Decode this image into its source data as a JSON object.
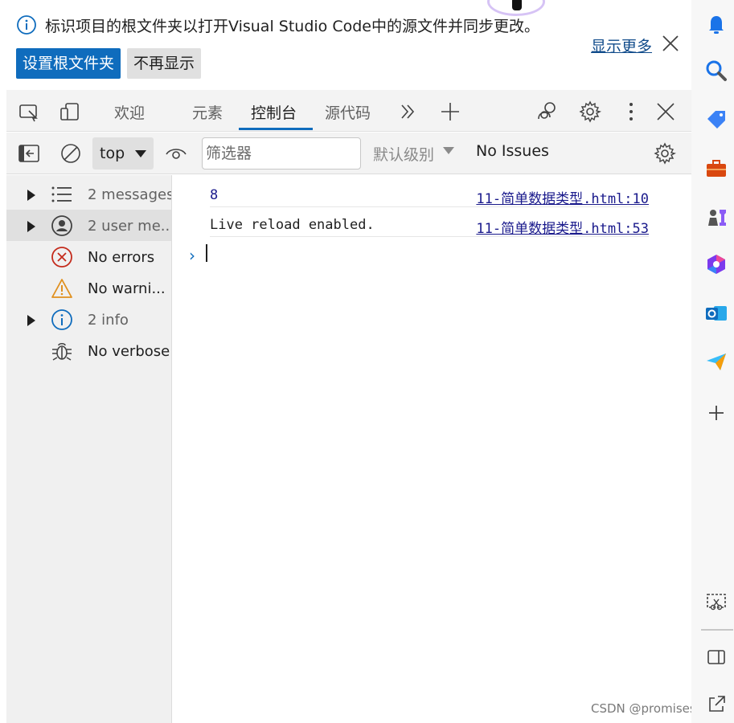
{
  "infobar": {
    "message": "标识项目的根文件夹以打开Visual Studio Code中的源文件并同步更改。",
    "primary_button": "设置根文件夹",
    "secondary_button": "不再显示",
    "show_more": "显示更多"
  },
  "tabs": [
    {
      "label": "欢迎",
      "active": false
    },
    {
      "label": "元素",
      "active": false
    },
    {
      "label": "控制台",
      "active": true
    },
    {
      "label": "源代码",
      "active": false
    }
  ],
  "toolbar": {
    "context": "top",
    "filter_placeholder": "筛选器",
    "levels": "默认级别",
    "issues": "No Issues"
  },
  "sidebar": {
    "items": [
      {
        "label": "2 messages",
        "icon": "list-icon",
        "expandable": true
      },
      {
        "label": "2 user me...",
        "icon": "user-icon",
        "expandable": true
      },
      {
        "label": "No errors",
        "icon": "error-icon",
        "expandable": false
      },
      {
        "label": "No warni...",
        "icon": "warning-icon",
        "expandable": false
      },
      {
        "label": "2 info",
        "icon": "info-icon",
        "expandable": true
      },
      {
        "label": "No verbose",
        "icon": "bug-icon",
        "expandable": false
      }
    ]
  },
  "console": {
    "messages": [
      {
        "value": "8",
        "source": "11-简单数据类型.html:10"
      },
      {
        "value": "Live reload enabled.",
        "source": "11-简单数据类型.html:53"
      }
    ]
  },
  "watermark": "CSDN @promises_ma",
  "colors": {
    "accent": "#0f6cbd",
    "number": "#1a1a8c",
    "error": "#c42b1c",
    "warning": "#e0901f"
  }
}
